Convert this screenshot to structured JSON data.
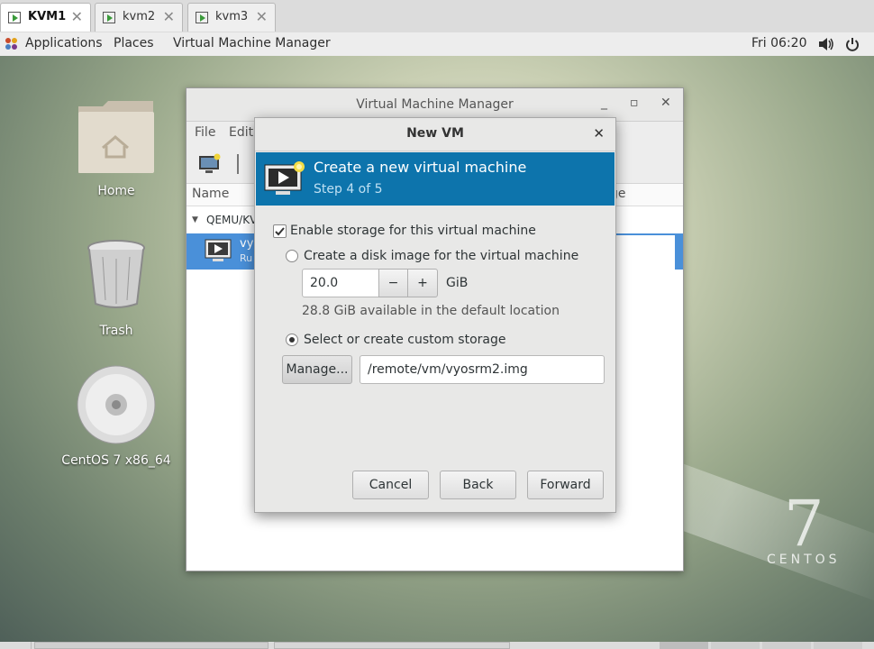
{
  "tabs": [
    {
      "label": "KVM1",
      "active": true
    },
    {
      "label": "kvm2",
      "active": false
    },
    {
      "label": "kvm3",
      "active": false
    }
  ],
  "topbar": {
    "applications": "Applications",
    "places": "Places",
    "vmm": "Virtual Machine Manager",
    "clock": "Fri 06:20"
  },
  "desktop": {
    "icons": [
      {
        "label": "Home",
        "icon": "folder-home-icon"
      },
      {
        "label": "Trash",
        "icon": "trash-icon"
      },
      {
        "label": "CentOS 7 x86_64",
        "icon": "disc-icon"
      }
    ],
    "brand_number": "7",
    "brand_text": "CENTOS"
  },
  "vmm_window": {
    "title": "Virtual Machine Manager",
    "menu": [
      "File",
      "Edit"
    ],
    "columns": {
      "name": "Name",
      "usage": "ge"
    },
    "group": "QEMU/KV",
    "vm_name": "vy",
    "vm_status": "Ru"
  },
  "dialog": {
    "title": "New VM",
    "banner_title": "Create a new virtual machine",
    "banner_step": "Step 4 of 5",
    "enable_storage": "Enable storage for this virtual machine",
    "create_disk": "Create a disk image for the virtual machine",
    "size_value": "20.0",
    "size_unit": "GiB",
    "available": "28.8 GiB available in the default location",
    "custom_storage": "Select or create custom storage",
    "manage_label": "Manage...",
    "path_value": "/remote/vm/vyosrm2.img",
    "minus": "−",
    "plus": "+",
    "cancel": "Cancel",
    "back": "Back",
    "forward": "Forward"
  }
}
